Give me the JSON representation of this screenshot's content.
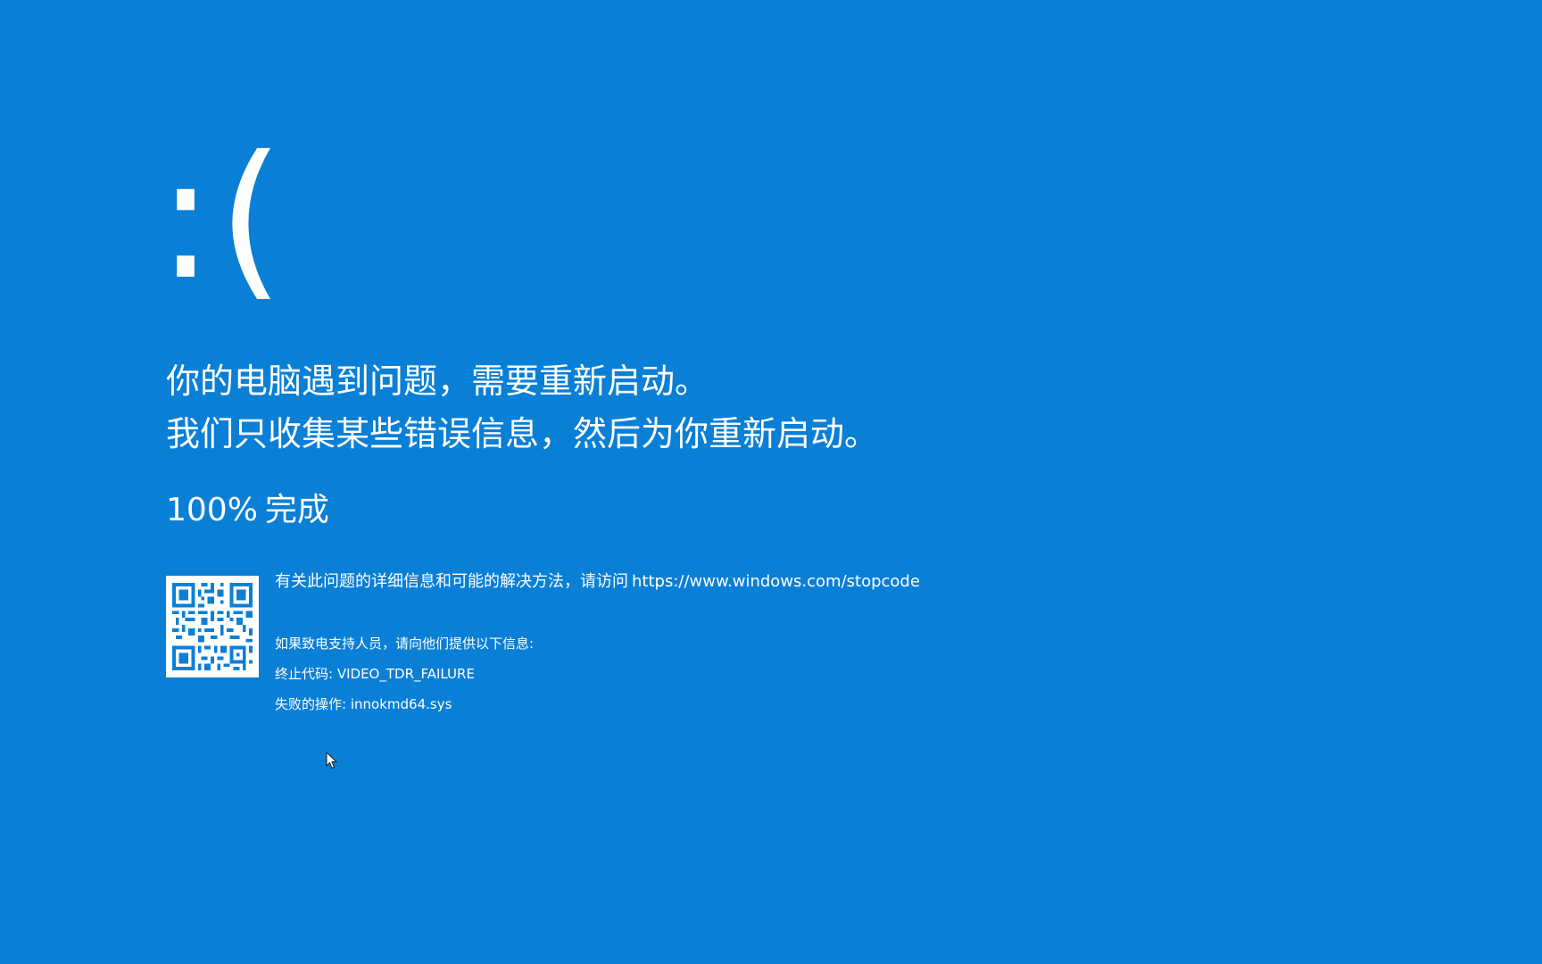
{
  "bsod": {
    "emoticon": ":(",
    "headline_line1": "你的电脑遇到问题，需要重新启动。",
    "headline_line2": "我们只收集某些错误信息，然后为你重新启动。",
    "progress_percent": "100%",
    "progress_label": "完成",
    "more_info_text": "有关此问题的详细信息和可能的解决方法，请访问",
    "more_info_url": "https://www.windows.com/stopcode",
    "support_intro": "如果致电支持人员，请向他们提供以下信息:",
    "stop_code_label": "终止代码:",
    "stop_code_value": "VIDEO_TDR_FAILURE",
    "failed_label": "失败的操作:",
    "failed_value": "innokmd64.sys"
  },
  "colors": {
    "background": "#0a7fd6",
    "text": "#ffffff"
  },
  "icons": {
    "qr": "qr-code-icon",
    "cursor": "mouse-pointer-icon"
  }
}
